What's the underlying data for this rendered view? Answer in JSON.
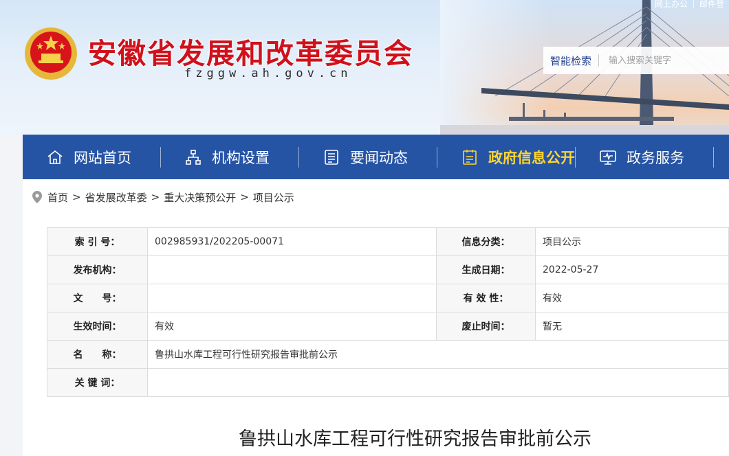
{
  "header": {
    "site_title": "安徽省发展和改革委员会",
    "site_domain": "fzggw.ah.gov.cn",
    "top_links": [
      "网上办公",
      "邮件登"
    ],
    "search": {
      "label": "智能检索",
      "placeholder": "输入搜索关键字"
    }
  },
  "nav": {
    "items": [
      {
        "label": "网站首页",
        "icon": "home-icon"
      },
      {
        "label": "机构设置",
        "icon": "org-chart-icon"
      },
      {
        "label": "要闻动态",
        "icon": "newspaper-icon"
      },
      {
        "label": "政府信息公开",
        "icon": "document-list-icon",
        "active": true
      },
      {
        "label": "政务服务",
        "icon": "monitor-icon"
      }
    ],
    "active_color": "#ffd52e",
    "bg_color": "#2654a5"
  },
  "breadcrumb": {
    "items": [
      "首页",
      "省发展改革委",
      "重大决策预公开",
      "项目公示"
    ],
    "separator": ">"
  },
  "meta_table": {
    "index_label": "索 引 号：",
    "index_value": "002985931/202205-00071",
    "category_label": "信息分类：",
    "category_value": "项目公示",
    "publisher_label": "发布机构：",
    "publisher_value": "",
    "date_label": "生成日期：",
    "date_value": "2022-05-27",
    "docno_label": "文　　号：",
    "docno_value": "",
    "validity_label": "有 效 性：",
    "validity_value": "有效",
    "effective_label": "生效时间：",
    "effective_value": "有效",
    "expire_label": "废止时间：",
    "expire_value": "暂无",
    "name_label": "名　　称：",
    "name_value": "鲁拱山水库工程可行性研究报告审批前公示",
    "keywords_label": "关 键 词：",
    "keywords_value": ""
  },
  "article": {
    "title": "鲁拱山水库工程可行性研究报告审批前公示"
  },
  "colors": {
    "title_red": "#d0111b",
    "nav_blue": "#2654a5"
  }
}
